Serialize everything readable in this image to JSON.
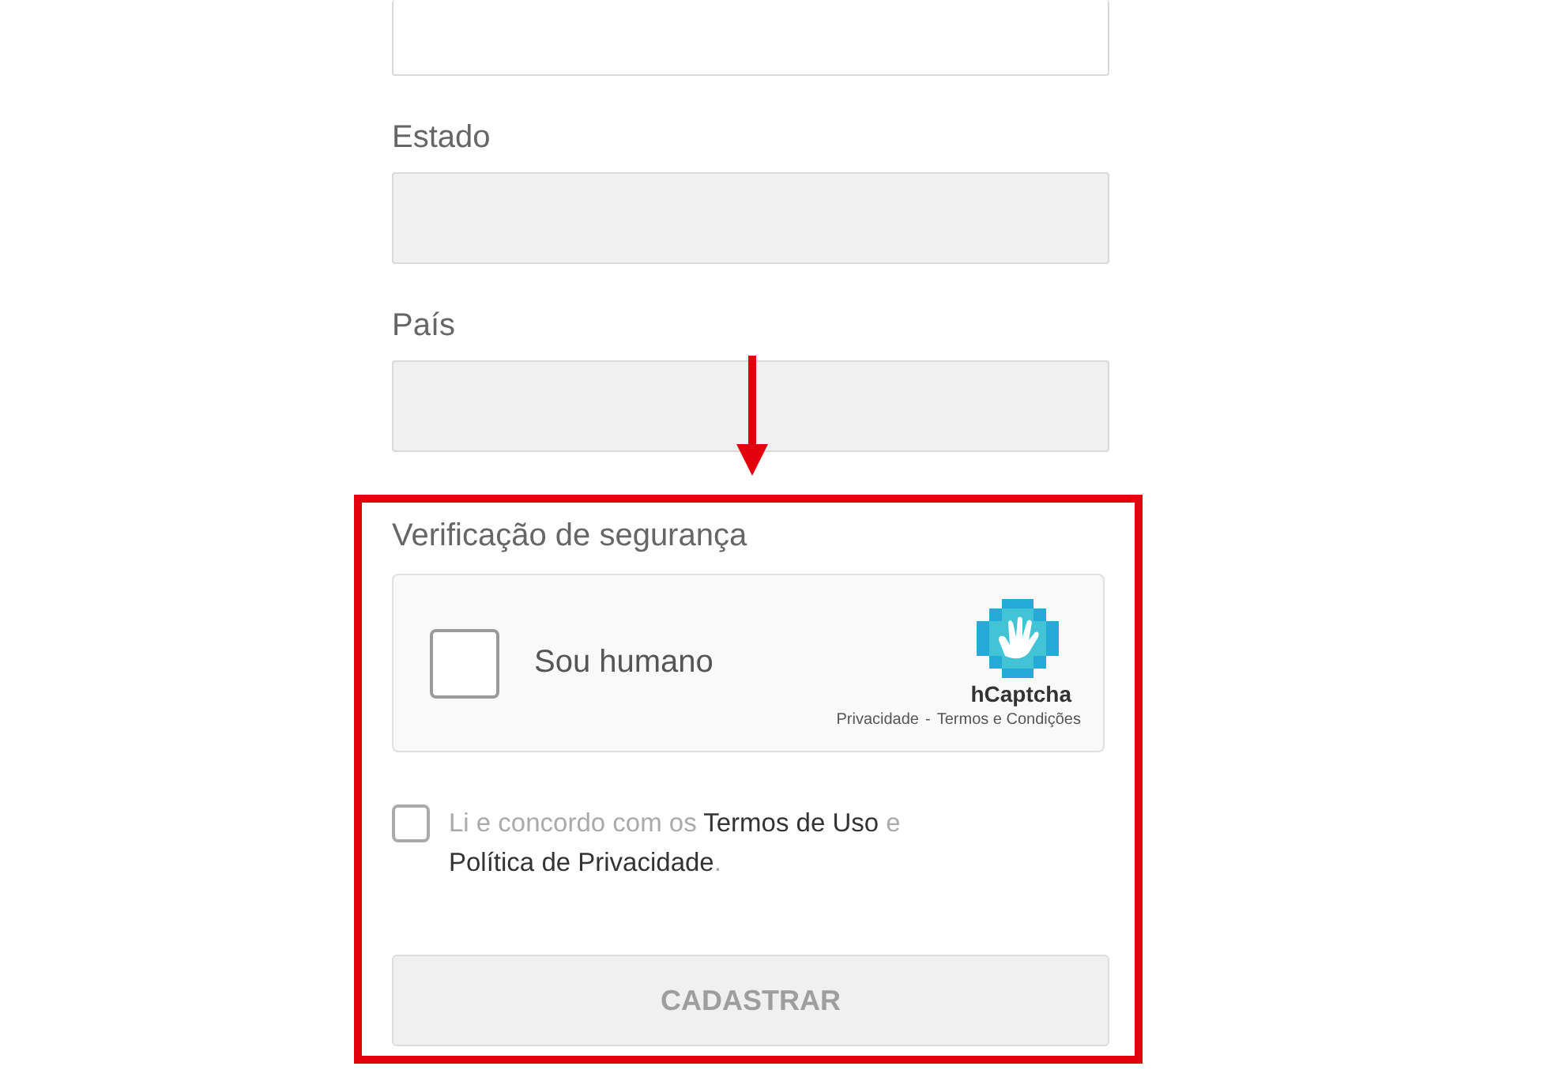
{
  "fields": [
    {
      "disabled": false
    },
    {
      "label": "Estado",
      "disabled": true
    },
    {
      "label": "País",
      "disabled": true
    }
  ],
  "security": {
    "heading": "Verificação de segurança",
    "captcha": {
      "label": "Sou humano",
      "checked": false,
      "brand": "hCaptcha",
      "privacy_link": "Privacidade",
      "separator": "-",
      "terms_link": "Termos e Condições"
    },
    "agreement": {
      "checked": false,
      "parts": [
        {
          "kind": "text",
          "text": "Li e concordo com os "
        },
        {
          "kind": "link",
          "text": "Termos de Uso"
        },
        {
          "kind": "text",
          "text": " e "
        },
        {
          "kind": "link",
          "text": "Política de Privacidade"
        },
        {
          "kind": "text",
          "text": "."
        }
      ]
    },
    "submit": {
      "label": "CADASTRAR",
      "disabled": true
    }
  }
}
